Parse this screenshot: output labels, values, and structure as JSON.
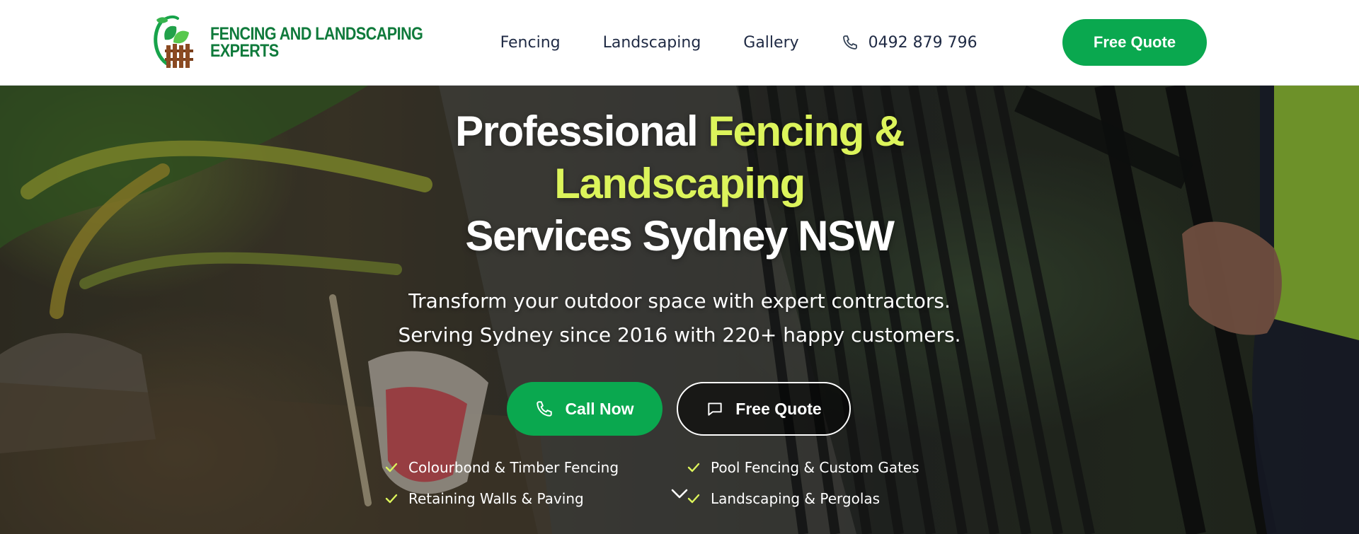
{
  "header": {
    "logo_text_line1": "FENCING AND LANDSCAPING",
    "logo_text_line2": "EXPERTS",
    "nav": [
      "Fencing",
      "Landscaping",
      "Gallery"
    ],
    "phone": "0492 879 796",
    "quote_label": "Free Quote"
  },
  "hero": {
    "title_part1": "Professional ",
    "title_accent1": "Fencing &",
    "title_accent2": "Landscaping",
    "title_part2": "Services Sydney NSW",
    "subtitle_line1": "Transform your outdoor space with expert contractors.",
    "subtitle_line2": "Serving Sydney since 2016 with 220+ happy customers.",
    "call_label": "Call Now",
    "quote_label": "Free Quote",
    "features": [
      "Colourbond & Timber Fencing",
      "Pool Fencing & Custom Gates",
      "Retaining Walls & Paving",
      "Landscaping & Pergolas"
    ]
  },
  "colors": {
    "brand_green": "#0aa84f",
    "logo_green": "#0f7a3b",
    "accent_yellow": "#dcf45b",
    "nav_text": "#1f2a44"
  },
  "icons": {
    "phone": "phone-icon",
    "chat": "chat-icon",
    "check": "check-icon",
    "chevron": "chevron-down-icon"
  }
}
